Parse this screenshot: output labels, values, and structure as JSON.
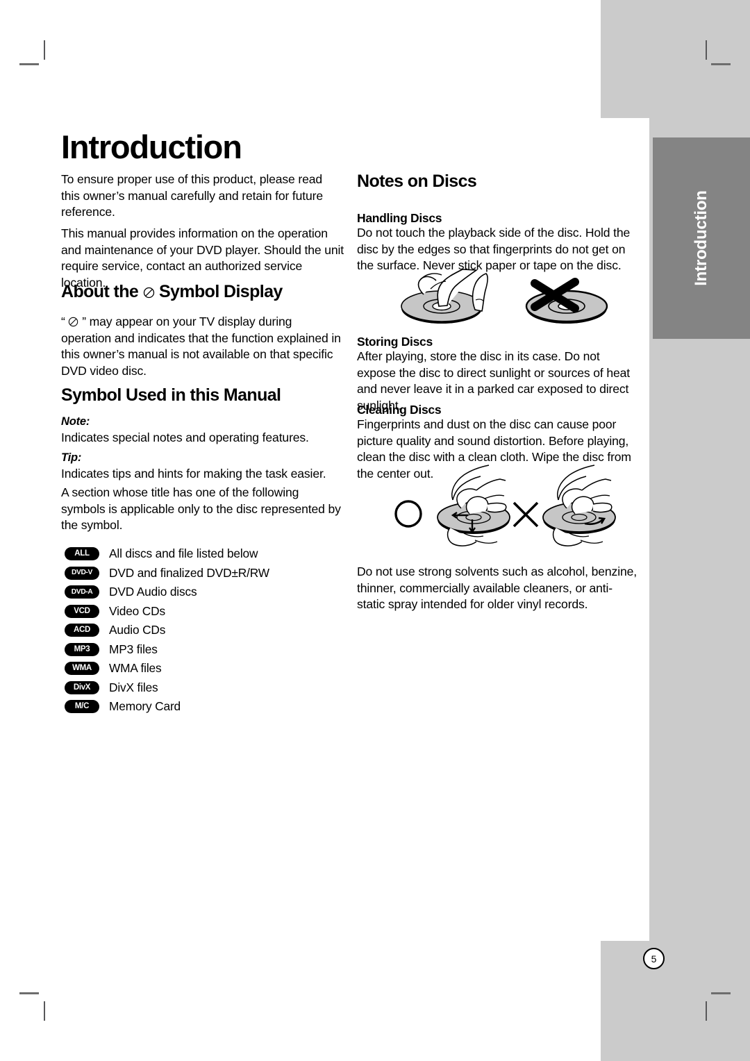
{
  "document": {
    "page_number": "5",
    "side_tab_label": "Introduction"
  },
  "left_column": {
    "title": "Introduction",
    "intro_paragraph_1": "To ensure proper use of this product, please read this owner’s manual carefully and retain for future reference.",
    "intro_paragraph_2": "This manual provides information on the operation and maintenance of your DVD player. Should the unit require service, contact an authorized service location.",
    "about_symbol": {
      "heading_before": "About the",
      "heading_symbol": "no-symbol",
      "heading_after": "Symbol Display",
      "body_before": "“",
      "body_after": "” may appear on your TV display during operation and indicates that the function explained in this owner’s manual is not available on that specific DVD video disc."
    },
    "symbol_used": {
      "heading": "Symbol Used in this Manual",
      "note_label": "Note:",
      "note_text": "Indicates special notes and operating features.",
      "tip_label": "Tip:",
      "tip_text": "Indicates tips and hints for making the task easier.",
      "applies_text": "A section whose title has one of the following symbols is applicable only to the disc represented by the symbol."
    },
    "symbol_list": [
      {
        "badge": "ALL",
        "label": "All discs and file listed below"
      },
      {
        "badge": "DVD-V",
        "label": "DVD and finalized DVD±R/RW"
      },
      {
        "badge": "DVD-A",
        "label": "DVD Audio discs"
      },
      {
        "badge": "VCD",
        "label": "Video CDs"
      },
      {
        "badge": "ACD",
        "label": "Audio CDs"
      },
      {
        "badge": "MP3",
        "label": "MP3 files"
      },
      {
        "badge": "WMA",
        "label": "WMA files"
      },
      {
        "badge": "DivX",
        "label": "DivX files"
      },
      {
        "badge": "M/C",
        "label": "Memory Card"
      }
    ]
  },
  "right_column": {
    "title": "Notes on Discs",
    "handling": {
      "heading": "Handling Discs",
      "text": "Do not touch the playback side of the disc. Hold the disc by the edges so that fingerprints do not get on the surface. Never stick paper or tape on the disc."
    },
    "storing": {
      "heading": "Storing Discs",
      "text": "After playing, store the disc in its case. Do not expose the disc to direct sunlight or sources of heat and never leave it in a parked car exposed to direct sunlight."
    },
    "cleaning": {
      "heading": "Cleaning Discs",
      "text": "Fingerprints and dust on the disc can cause poor picture quality and sound distortion. Before playing, clean the disc with a clean cloth. Wipe the disc from the center out."
    },
    "solvents_text": "Do not use strong solvents such as alcohol, benzine, thinner, commercially available cleaners, or anti-static spray intended for older vinyl records.",
    "figures": {
      "handling_ok": "hand-holding-disc-illustration",
      "handling_bad": "disc-with-x-mark-illustration",
      "cleaning_ok_mark": "circle-ok-mark",
      "cleaning_ok": "wipe-disc-from-center-out-illustration",
      "cleaning_bad_mark": "cross-x-mark",
      "cleaning_bad": "wipe-disc-circular-illustration"
    }
  },
  "colors": {
    "bleed_gray": "#cbcbcb",
    "tab_gray": "#848484",
    "badge_black": "#000000",
    "disc_gray": "#c6c6c6"
  }
}
